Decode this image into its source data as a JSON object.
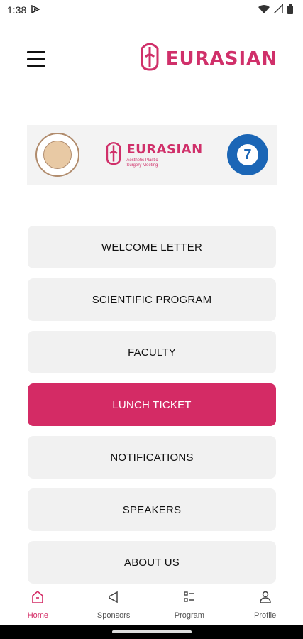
{
  "status_bar": {
    "time": "1:38"
  },
  "header": {
    "brand": "EURASIAN"
  },
  "banner": {
    "center_name": "EURASIAN",
    "center_sub": "Aesthetic Plastic Surgery Meeting",
    "seven_number": "7"
  },
  "menu": [
    {
      "label": "WELCOME LETTER"
    },
    {
      "label": "SCIENTIFIC PROGRAM"
    },
    {
      "label": "FACULTY"
    },
    {
      "label": "LUNCH TICKET"
    },
    {
      "label": "NOTIFICATIONS"
    },
    {
      "label": "SPEAKERS"
    },
    {
      "label": "ABOUT US"
    }
  ],
  "bottom_nav": [
    {
      "label": "Home",
      "icon": "home-icon"
    },
    {
      "label": "Sponsors",
      "icon": "megaphone-icon"
    },
    {
      "label": "Program",
      "icon": "list-icon"
    },
    {
      "label": "Profile",
      "icon": "person-icon"
    }
  ],
  "colors": {
    "accent": "#d42b65",
    "button_bg": "#f1f1f1"
  }
}
